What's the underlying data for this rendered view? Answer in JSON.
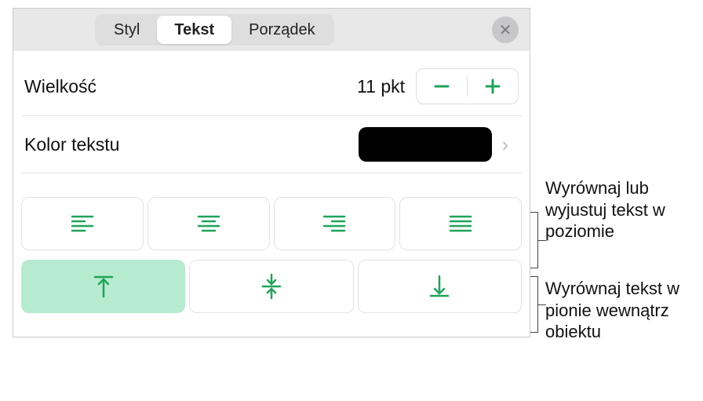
{
  "tabs": {
    "style": "Styl",
    "text": "Tekst",
    "order": "Porządek"
  },
  "size": {
    "label": "Wielkość",
    "value": "11 pkt"
  },
  "color": {
    "label": "Kolor tekstu",
    "hex": "#000000"
  },
  "callouts": {
    "horizontal": "Wyrównaj lub wyjustuj tekst w poziomie",
    "vertical": "Wyrównaj tekst w pionie wewnątrz obiektu"
  },
  "align": {
    "h": [
      "left",
      "center",
      "right",
      "justify"
    ],
    "v": [
      "top",
      "middle",
      "bottom"
    ],
    "v_selected": "top"
  }
}
